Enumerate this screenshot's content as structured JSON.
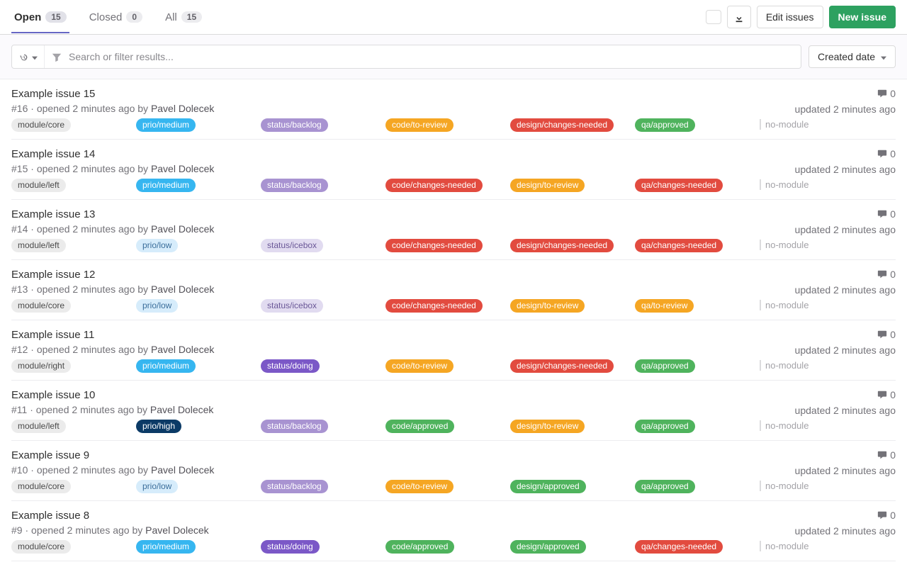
{
  "tabs": {
    "open": {
      "label": "Open",
      "count": "15"
    },
    "closed": {
      "label": "Closed",
      "count": "0"
    },
    "all": {
      "label": "All",
      "count": "15"
    }
  },
  "actions": {
    "edit_issues": "Edit issues",
    "new_issue": "New issue"
  },
  "filter": {
    "placeholder": "Search or filter results...",
    "sort_label": "Created date"
  },
  "label_classes": {
    "module/core": "label-module",
    "module/left": "label-module",
    "module/right": "label-module",
    "prio/medium": "label-prio-medium",
    "prio/low": "label-prio-low",
    "prio/high": "label-prio-high",
    "status/backlog": "label-status-backlog",
    "status/icebox": "label-status-icebox",
    "status/doing": "label-status-doing",
    "code/to-review": "label-code-review",
    "code/changes-needed": "label-code-changes",
    "code/approved": "label-code-approved",
    "design/changes-needed": "label-design-changes",
    "design/to-review": "label-design-review",
    "design/approved": "label-design-approved",
    "qa/approved": "label-qa-approved",
    "qa/changes-needed": "label-qa-changes",
    "qa/to-review": "label-qa-review"
  },
  "issues": [
    {
      "title": "Example issue 15",
      "ref": "#16",
      "opened": "opened 2 minutes ago by",
      "author": "Pavel Dolecek",
      "labels": [
        "module/core",
        "prio/medium",
        "status/backlog",
        "code/to-review",
        "design/changes-needed",
        "qa/approved"
      ],
      "scoped": "no-module",
      "comments": "0",
      "updated": "updated 2 minutes ago"
    },
    {
      "title": "Example issue 14",
      "ref": "#15",
      "opened": "opened 2 minutes ago by",
      "author": "Pavel Dolecek",
      "labels": [
        "module/left",
        "prio/medium",
        "status/backlog",
        "code/changes-needed",
        "design/to-review",
        "qa/changes-needed"
      ],
      "scoped": "no-module",
      "comments": "0",
      "updated": "updated 2 minutes ago"
    },
    {
      "title": "Example issue 13",
      "ref": "#14",
      "opened": "opened 2 minutes ago by",
      "author": "Pavel Dolecek",
      "labels": [
        "module/left",
        "prio/low",
        "status/icebox",
        "code/changes-needed",
        "design/changes-needed",
        "qa/changes-needed"
      ],
      "scoped": "no-module",
      "comments": "0",
      "updated": "updated 2 minutes ago"
    },
    {
      "title": "Example issue 12",
      "ref": "#13",
      "opened": "opened 2 minutes ago by",
      "author": "Pavel Dolecek",
      "labels": [
        "module/core",
        "prio/low",
        "status/icebox",
        "code/changes-needed",
        "design/to-review",
        "qa/to-review"
      ],
      "scoped": "no-module",
      "comments": "0",
      "updated": "updated 2 minutes ago"
    },
    {
      "title": "Example issue 11",
      "ref": "#12",
      "opened": "opened 2 minutes ago by",
      "author": "Pavel Dolecek",
      "labels": [
        "module/right",
        "prio/medium",
        "status/doing",
        "code/to-review",
        "design/changes-needed",
        "qa/approved"
      ],
      "scoped": "no-module",
      "comments": "0",
      "updated": "updated 2 minutes ago"
    },
    {
      "title": "Example issue 10",
      "ref": "#11",
      "opened": "opened 2 minutes ago by",
      "author": "Pavel Dolecek",
      "labels": [
        "module/left",
        "prio/high",
        "status/backlog",
        "code/approved",
        "design/to-review",
        "qa/approved"
      ],
      "scoped": "no-module",
      "comments": "0",
      "updated": "updated 2 minutes ago"
    },
    {
      "title": "Example issue 9",
      "ref": "#10",
      "opened": "opened 2 minutes ago by",
      "author": "Pavel Dolecek",
      "labels": [
        "module/core",
        "prio/low",
        "status/backlog",
        "code/to-review",
        "design/approved",
        "qa/approved"
      ],
      "scoped": "no-module",
      "comments": "0",
      "updated": "updated 2 minutes ago"
    },
    {
      "title": "Example issue 8",
      "ref": "#9",
      "opened": "opened 2 minutes ago by",
      "author": "Pavel Dolecek",
      "labels": [
        "module/core",
        "prio/medium",
        "status/doing",
        "code/approved",
        "design/approved",
        "qa/changes-needed"
      ],
      "scoped": "no-module",
      "comments": "0",
      "updated": "updated 2 minutes ago"
    }
  ]
}
